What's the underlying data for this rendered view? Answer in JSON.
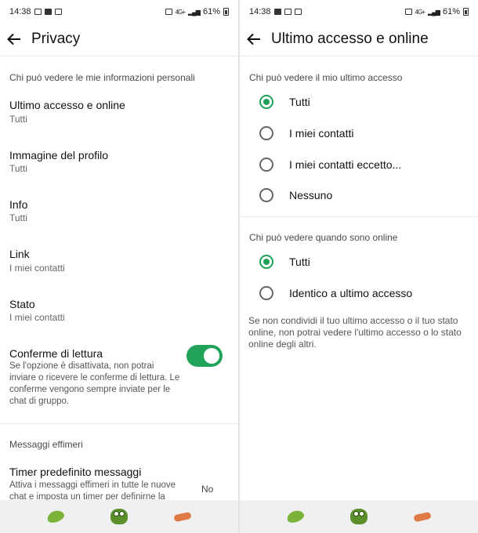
{
  "left_screen": {
    "status_bar": {
      "time": "14:38",
      "battery": "61%",
      "network": "4G+"
    },
    "title": "Privacy",
    "section_personal": "Chi può vedere le mie informazioni personali",
    "rows": [
      {
        "title": "Ultimo accesso e online",
        "value": "Tutti"
      },
      {
        "title": "Immagine del profilo",
        "value": "Tutti"
      },
      {
        "title": "Info",
        "value": "Tutti"
      },
      {
        "title": "Link",
        "value": "I miei contatti"
      },
      {
        "title": "Stato",
        "value": "I miei contatti"
      }
    ],
    "read_receipts": {
      "title": "Conferme di lettura",
      "description": "Se l'opzione è disattivata, non potrai inviare o ricevere le conferme di lettura. Le conferme vengono sempre inviate per le chat di gruppo.",
      "enabled": true
    },
    "section_ephemeral": "Messaggi effimeri",
    "timer": {
      "title": "Timer predefinito messaggi",
      "description": "Attiva i messaggi effimeri in tutte le nuove chat e imposta un timer per definirne la",
      "value": "No"
    }
  },
  "right_screen": {
    "status_bar": {
      "time": "14:38",
      "battery": "61%",
      "network": "4G+"
    },
    "title": "Ultimo accesso e online",
    "section_last_seen": "Chi può vedere il mio ultimo accesso",
    "last_seen_options": [
      {
        "label": "Tutti",
        "selected": true
      },
      {
        "label": "I miei contatti",
        "selected": false
      },
      {
        "label": "I miei contatti eccetto...",
        "selected": false
      },
      {
        "label": "Nessuno",
        "selected": false
      }
    ],
    "section_online": "Chi può vedere quando sono online",
    "online_options": [
      {
        "label": "Tutti",
        "selected": true
      },
      {
        "label": "Identico a ultimo accesso",
        "selected": false
      }
    ],
    "note": "Se non condividi il tuo ultimo accesso o il tuo stato online, non potrai vedere l'ultimo accesso o lo stato online degli altri."
  },
  "colors": {
    "accent": "#21a45a",
    "background": "#ffffff",
    "nav_bar": "#f0f0f0"
  },
  "nav_icons": [
    "leaf-sticker-icon",
    "frog-sticker-icon",
    "shrimp-sticker-icon"
  ]
}
